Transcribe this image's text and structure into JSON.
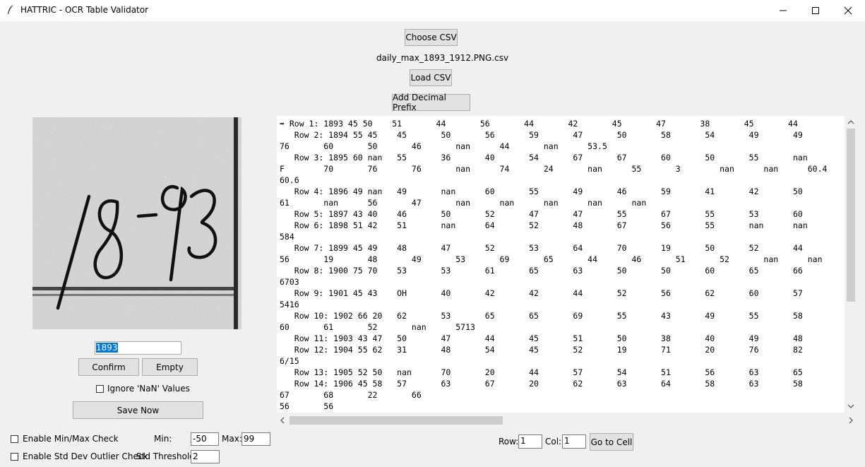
{
  "window": {
    "title": "HATTRIC - OCR Table Validator",
    "minimize_glyph": "—",
    "maximize_glyph": "☐",
    "close_glyph": "✕"
  },
  "toolbar": {
    "choose_csv_label": "Choose CSV",
    "filename": "daily_max_1893_1912.PNG.csv",
    "load_csv_label": "Load CSV",
    "decimal_prefix_label": "Add Decimal Prefix"
  },
  "cell_image": {
    "text": "1893"
  },
  "editor": {
    "value": "1893",
    "confirm_label": "Confirm",
    "empty_label": "Empty",
    "ignore_nan_label": "Ignore 'NaN' Values",
    "ignore_nan_checked": false,
    "save_label": "Save Now"
  },
  "table_lines": [
    "➡ Row 1: 1893 45 50    51       44       56       44       42       45       47       38       45       44",
    "   Row 2: 1894 55 45    45       50       56       59       47       50       58       54       49       49",
    "76       60       50       46       nan      44       nan      53.5",
    "   Row 3: 1895 60 nan   55       36       40       54       67       67       60       50       55       nan",
    "F        70       76       76       nan      74       24       nan      55       3        nan      nan      60.4",
    "60.6",
    "   Row 4: 1896 49 nan   49       nan      60       55       49       46       59       41       42       50",
    "61       nan      56       47       nan      nan      nan      nan      nan",
    "   Row 5: 1897 43 40    46       50       52       47       47       55       67       55       53       60",
    "   Row 6: 1898 51 42    51       nan      64       52       48       67       56       55       nan      nan",
    "584",
    "   Row 7: 1899 45 49    48       47       52       53       64       70       19       50       52       44",
    "56       19       48       49       53       69       65       44       46       51       52       nan      nan",
    "   Row 8: 1900 75 70    53       53       61       65       63       50       50       60       65       66",
    "6703",
    "   Row 9: 1901 45 43    OH       40       42       42       44       52       56       62       60       57",
    "5416",
    "   Row 10: 1902 66 20   62       53       65       65       69       55       43       49       55       58",
    "60       61       52       nan      5713",
    "   Row 11: 1903 43 47   50       47       44       45       51       50       38       40       49       48",
    "   Row 12: 1904 55 62   31       48       54       45       52       19       71       20       76       82",
    "6/15",
    "   Row 13: 1905 52 50   nan      70       20       44       57       54       51       56       63       65",
    "   Row 14: 1906 45 58   57       63       67       20       62       63       64       58       63       58",
    "67       68       22       66",
    "56       56"
  ],
  "validation": {
    "minmax_label": "Enable Min/Max Check",
    "minmax_checked": false,
    "min_label": "Min:",
    "min_value": "-50",
    "max_label": "Max:",
    "max_value": "99",
    "std_label": "Enable Std Dev Outlier Check",
    "std_checked": false,
    "std_threshold_label": "Std Threshold:",
    "std_threshold_value": "2"
  },
  "navigation": {
    "row_label": "Row:",
    "row_value": "1",
    "col_label": "Col:",
    "col_value": "1",
    "goto_label": "Go to Cell"
  },
  "icons": {
    "app": "feather-icon",
    "scroll_up": "▲",
    "scroll_down": "▼",
    "scroll_left": "◀",
    "scroll_right": "▶"
  }
}
